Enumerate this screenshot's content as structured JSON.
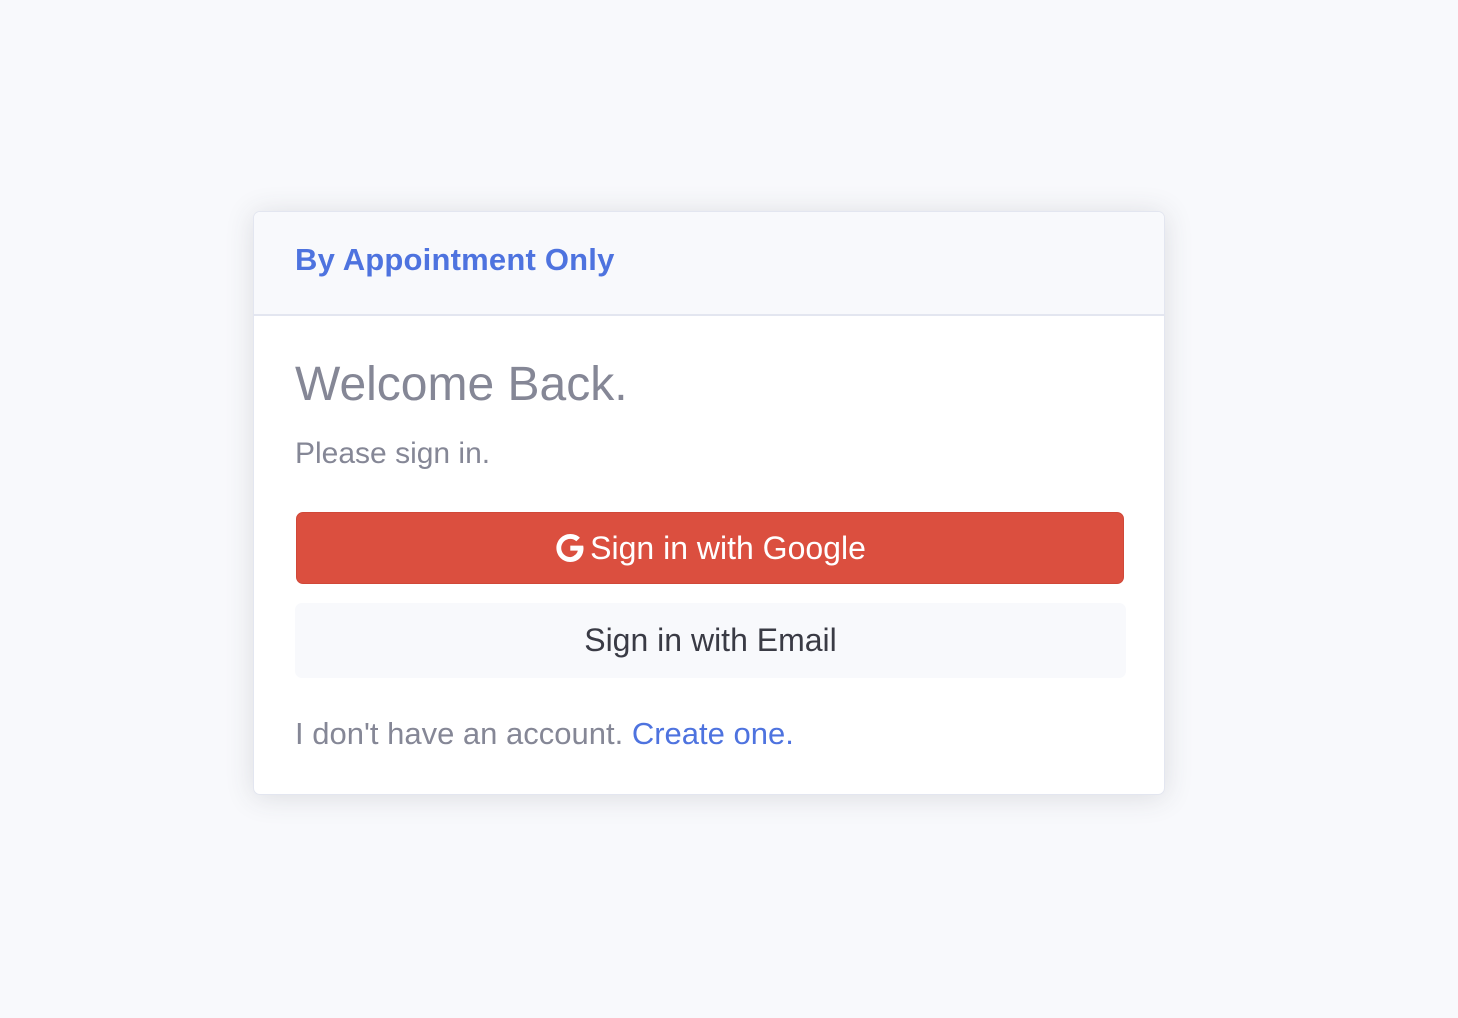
{
  "brand": {
    "title": "By Appointment Only",
    "color": "#4e73df"
  },
  "login": {
    "heading": "Welcome Back.",
    "subtitle": "Please sign in.",
    "google_button": {
      "icon": "google-icon",
      "label": "Sign in with Google",
      "color": "#db4f3f"
    },
    "email_button": {
      "label": "Sign in with Email"
    },
    "footer": {
      "text": "I don't have an account.",
      "link_label": "Create one."
    }
  }
}
